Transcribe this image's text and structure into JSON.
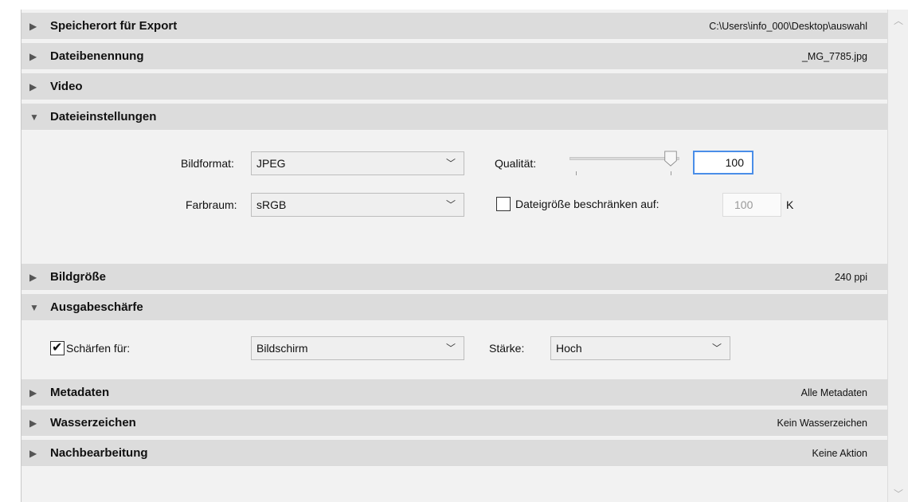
{
  "sections": {
    "export_location": {
      "title": "Speicherort für Export",
      "summary": "C:\\Users\\info_000\\Desktop\\auswahl",
      "expanded": false
    },
    "file_naming": {
      "title": "Dateibenennung",
      "summary": "_MG_7785.jpg",
      "expanded": false
    },
    "video": {
      "title": "Video",
      "summary": "",
      "expanded": false
    },
    "file_settings": {
      "title": "Dateieinstellungen",
      "expanded": true,
      "format_label": "Bildformat:",
      "format_value": "JPEG",
      "quality_label": "Qualität:",
      "quality_value": "100",
      "quality_level": 1.0,
      "colorspace_label": "Farbraum:",
      "colorspace_value": "sRGB",
      "limit_label": "Dateigröße beschränken auf:",
      "limit_checked": false,
      "limit_value": "100",
      "limit_unit": "K"
    },
    "image_size": {
      "title": "Bildgröße",
      "summary": "240 ppi",
      "expanded": false
    },
    "output_sharpening": {
      "title": "Ausgabeschärfe",
      "expanded": true,
      "sharpen_label": "Schärfen für:",
      "sharpen_checked": true,
      "sharpen_value": "Bildschirm",
      "amount_label": "Stärke:",
      "amount_value": "Hoch"
    },
    "metadata": {
      "title": "Metadaten",
      "summary": "Alle Metadaten",
      "expanded": false
    },
    "watermark": {
      "title": "Wasserzeichen",
      "summary": "Kein Wasserzeichen",
      "expanded": false
    },
    "post_processing": {
      "title": "Nachbearbeitung",
      "summary": "Keine Aktion",
      "expanded": false
    }
  },
  "icons": {
    "collapsed": "triangle-right-icon",
    "expanded": "triangle-down-icon",
    "dropdown": "chevron-down-icon",
    "checkmark": "checkmark-icon"
  },
  "colors": {
    "header_bg": "#dcdcdc",
    "panel_bg": "#f2f2f2",
    "focus_border": "#4a8ee8"
  }
}
